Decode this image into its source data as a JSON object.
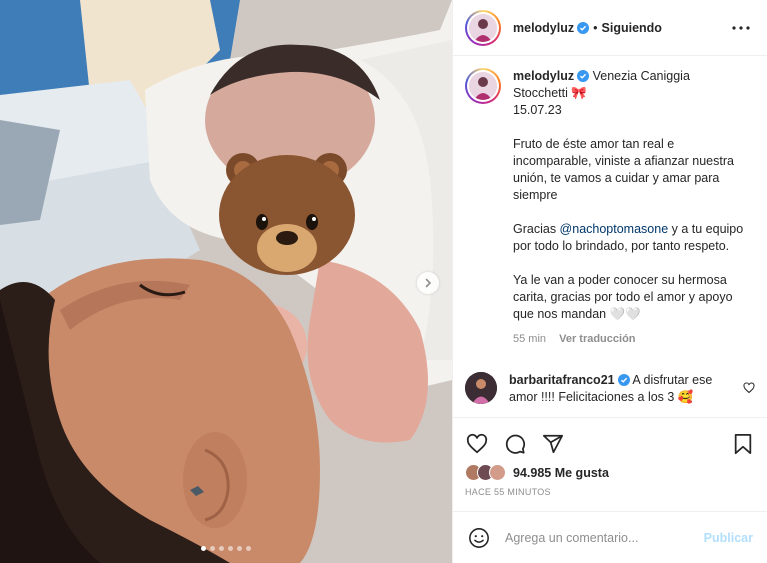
{
  "post": {
    "author": "melodyluz",
    "follow_status": "Siguiendo",
    "separator": "•",
    "caption": {
      "username": "melodyluz",
      "line1": "Venezia Caniggia Stocchetti 🎀",
      "date": "15.07.23",
      "para1": "Fruto de éste amor tan real e incomparable, viniste a afianzar nuestra unión, te vamos a cuidar y amar para siempre",
      "para2_prefix": "Gracias ",
      "para2_mention": "@nachoptomasone",
      "para2_suffix": " y a tu equipo por todo lo brindado, por tanto respeto.",
      "para3": "Ya le van a poder conocer su hermosa carita, gracias por todo el amor y apoyo que nos mandan 🤍🤍",
      "time": "55 min",
      "translate_label": "Ver traducción"
    },
    "comment": {
      "username": "barbaritafranco21",
      "text": "A disfrutar ese amor !!!! Felicitaciones a los 3 🥰"
    },
    "likes_count": "94.985",
    "likes_label": "Me gusta",
    "time_ago": "HACE 55 MINUTOS",
    "input_placeholder": "Agrega un comentario...",
    "publish_label": "Publicar"
  },
  "carousel": {
    "dot_count": 6,
    "active_index": 0
  },
  "icons": {
    "more": "more-icon",
    "verified": "verified-icon",
    "like": "heart-icon",
    "comment": "comment-icon",
    "share": "share-icon",
    "save": "bookmark-icon",
    "emoji": "emoji-icon",
    "next": "chevron-right-icon"
  },
  "colors": {
    "verified": "#3897f0",
    "mention": "#00376b",
    "publish_disabled": "#b2dffc",
    "muted": "#8e8e8e"
  }
}
